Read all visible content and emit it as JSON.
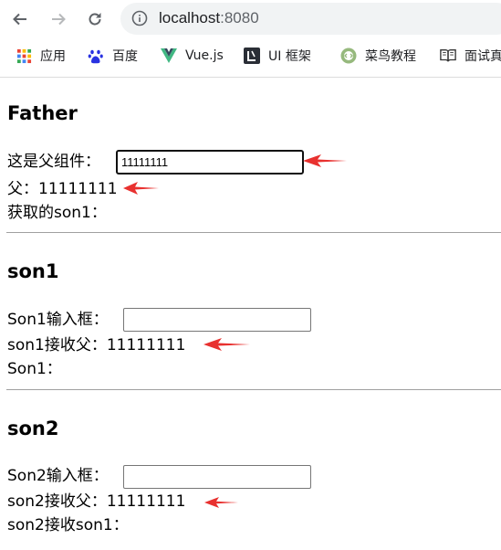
{
  "browser": {
    "url_host": "localhost",
    "url_port": ":8080",
    "bookmarks": [
      {
        "label": "应用",
        "icon": "apps-grid-icon"
      },
      {
        "label": "百度",
        "icon": "baidu-paw-icon"
      },
      {
        "label": "Vue.js",
        "icon": "vue-logo-icon"
      },
      {
        "label": "UI 框架",
        "icon": "ui-framework-icon"
      },
      {
        "label": "菜鸟教程",
        "icon": "runoob-icon"
      },
      {
        "label": "面试真",
        "icon": "book-icon"
      }
    ]
  },
  "father": {
    "title": "Father",
    "input_label": "这是父组件：",
    "input_value": "11111111",
    "display_label": "父：",
    "display_value": "11111111",
    "son1_label": "获取的son1："
  },
  "son1": {
    "title": "son1",
    "input_label": "Son1输入框：",
    "input_value": "",
    "receive_label": "son1接收父：",
    "receive_value": "11111111",
    "self_label": "Son1："
  },
  "son2": {
    "title": "son2",
    "input_label": "Son2输入框：",
    "input_value": "",
    "receive_label": "son2接收父：",
    "receive_value": "11111111",
    "son1_label": "son2接收son1："
  },
  "colors": {
    "arrow": "#e8312f",
    "chrome_icon": "#5f6368"
  }
}
